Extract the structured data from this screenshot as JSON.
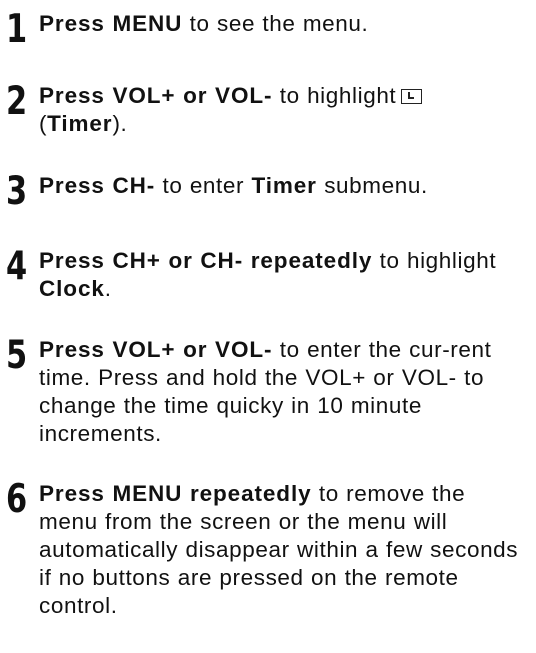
{
  "steps": [
    {
      "number": "1",
      "lead": "Press MENU",
      "rest": " to see the menu."
    },
    {
      "number": "2",
      "lead": "Press VOL+ or VOL-",
      "rest": " to highlight",
      "icon": "timer-icon",
      "paren_open": "(",
      "bold_word": "Timer",
      "paren_close": ")."
    },
    {
      "number": "3",
      "lead": "Press CH-",
      "rest": " to enter ",
      "bold_word": "Timer",
      "tail": " submenu."
    },
    {
      "number": "4",
      "lead": "Press CH+ or CH- repeatedly",
      "rest": " to highlight ",
      "bold_word": "Clock",
      "tail": "."
    },
    {
      "number": "5",
      "lead": "Press VOL+ or VOL-",
      "rest": " to enter the cur-rent time. Press and hold the VOL+ or VOL- to change the time quicky in 10 minute increments."
    },
    {
      "number": "6",
      "lead": "Press MENU repeatedly",
      "rest": " to remove the menu from the screen or the menu will automatically disappear within a few seconds if no buttons are pressed on the remote control."
    }
  ]
}
